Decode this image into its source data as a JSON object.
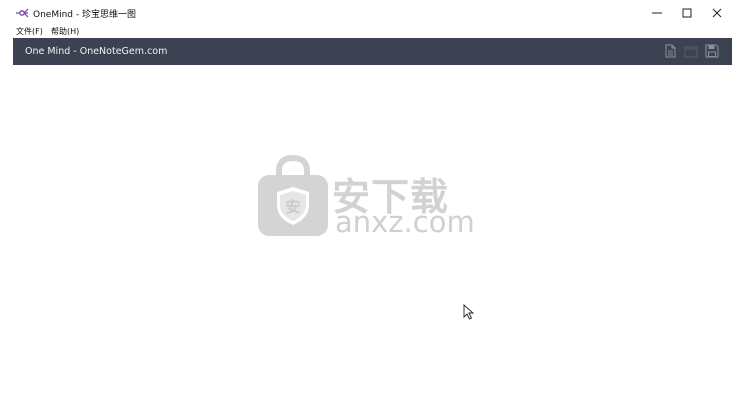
{
  "window": {
    "title": "OneMind - 珍宝思维一图"
  },
  "menu": {
    "file": "文件(F)",
    "help": "帮助(H)"
  },
  "header": {
    "title": "One Mind - OneNoteGem.com"
  },
  "toolbar": {
    "icons": [
      "new-document-icon",
      "open-folder-icon",
      "save-icon"
    ]
  },
  "watermark": {
    "brand": "安下载",
    "domain": "anxz.com",
    "shield_glyph": "安"
  },
  "colors": {
    "header_bg": "#3d4252",
    "header_text": "#f2f3f5",
    "app_icon": "#7b3fa8",
    "watermark": "#d2d2d2"
  }
}
